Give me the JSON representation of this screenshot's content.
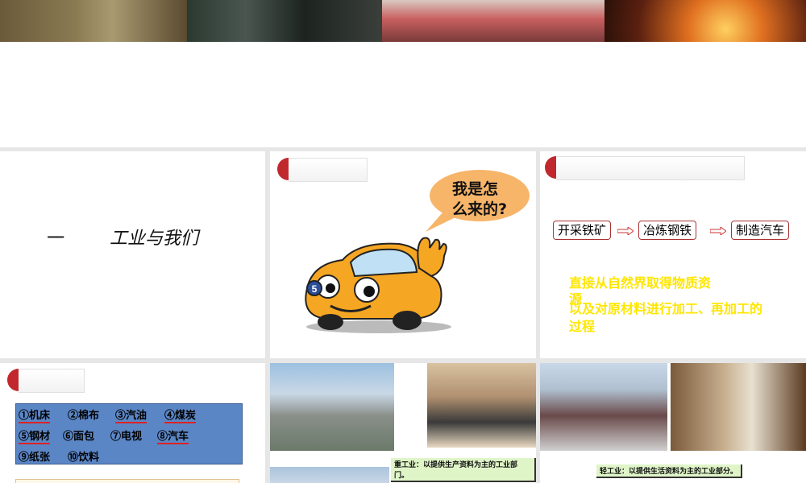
{
  "slide_top": {
    "photos": [
      "coal-mine-photo",
      "engine-factory-photo",
      "crowd-rocket-photo",
      "steel-furnace-photo"
    ]
  },
  "slide1": {
    "number": "一",
    "title": "工业与我们"
  },
  "slide2": {
    "bubble_line1": "我是怎",
    "bubble_line2": "么来的?",
    "car_number": "5"
  },
  "slide3": {
    "steps": [
      "开采铁矿",
      "冶炼钢铁",
      "制造汽车"
    ],
    "line1": "直接从自然界取得物质资",
    "line1b": "源",
    "line2": "以及对原材料进行加工、再加工的",
    "line2b": "过程"
  },
  "slide4": {
    "items": [
      {
        "label": "①机床",
        "underline": true
      },
      {
        "label": "②棉布",
        "underline": false
      },
      {
        "label": "③汽油",
        "underline": true
      },
      {
        "label": "④煤炭",
        "underline": true
      },
      {
        "label": "⑤钢材",
        "underline": true
      },
      {
        "label": "⑥面包",
        "underline": false
      },
      {
        "label": "⑦电视",
        "underline": false
      },
      {
        "label": "⑧汽车",
        "underline": true
      },
      {
        "label": "⑨纸张",
        "underline": false
      },
      {
        "label": "⑩饮料",
        "underline": false
      }
    ]
  },
  "slide5": {
    "caption": "重工业：以提供生产资料为主的工业部门。"
  },
  "slide6": {
    "caption": "轻工业：以提供生活资料为主的工业部分。"
  },
  "colors": {
    "accent_red": "#c0282d",
    "yellow_text": "#ffe600",
    "list_bg": "#5b86c6"
  }
}
